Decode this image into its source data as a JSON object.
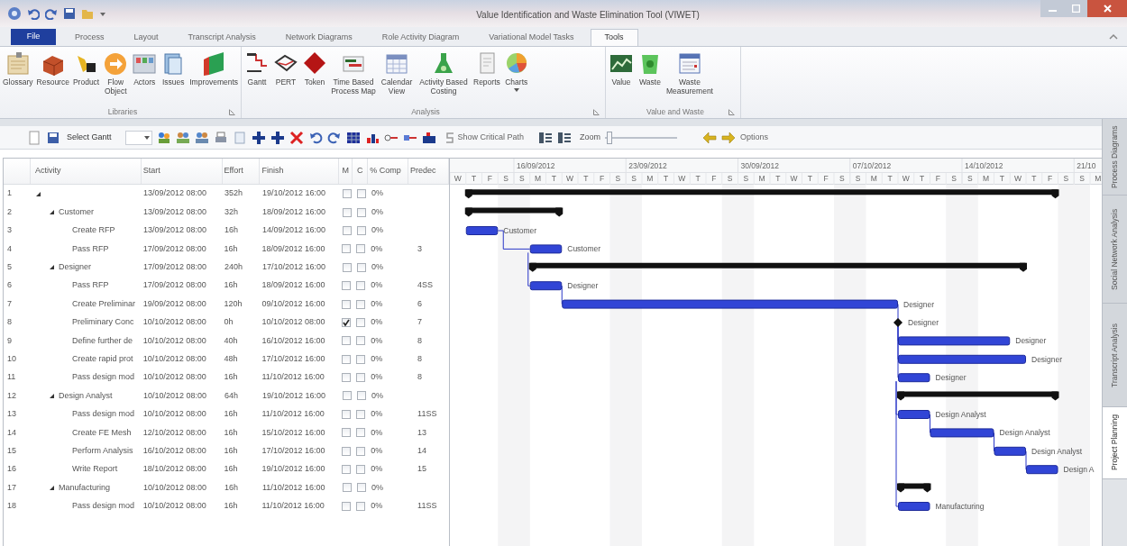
{
  "window": {
    "title": "Value Identification and Waste Elimination Tool (VIWET)"
  },
  "ribbon": {
    "tabs": [
      {
        "label": "File",
        "selected": false
      },
      {
        "label": "Process",
        "selected": false
      },
      {
        "label": "Layout",
        "selected": false
      },
      {
        "label": "Transcript Analysis",
        "selected": false
      },
      {
        "label": "Network Diagrams",
        "selected": false
      },
      {
        "label": "Role Activity Diagram",
        "selected": false
      },
      {
        "label": "Variational Model Tasks",
        "selected": false
      },
      {
        "label": "Tools",
        "selected": true
      }
    ],
    "groups": [
      {
        "label": "Libraries",
        "buttons": [
          {
            "label": "Glossary"
          },
          {
            "label": "Resource"
          },
          {
            "label": "Product"
          },
          {
            "label": "Flow Object"
          },
          {
            "label": "Actors"
          },
          {
            "label": "Issues"
          },
          {
            "label": "Improvements"
          }
        ]
      },
      {
        "label": "Analysis",
        "buttons": [
          {
            "label": "Gantt"
          },
          {
            "label": "PERT"
          },
          {
            "label": "Token"
          },
          {
            "label": "Time Based Process Map"
          },
          {
            "label": "Calendar View"
          },
          {
            "label": "Activity Based Costing"
          },
          {
            "label": "Reports"
          },
          {
            "label": "Charts"
          }
        ]
      },
      {
        "label": "Value and Waste",
        "buttons": [
          {
            "label": "Value"
          },
          {
            "label": "Waste"
          },
          {
            "label": "Waste Measurement"
          }
        ]
      }
    ]
  },
  "toolbar": {
    "select_gantt": "Select Gantt",
    "critical_path": "Show Critical Path",
    "zoom_label": "Zoom",
    "zoom": {
      "level": 0.02
    },
    "options": "Options"
  },
  "grid": {
    "columns": [
      "Activity",
      "Start",
      "Effort",
      "Finish",
      "M",
      "C",
      "% Comp",
      "Predec"
    ],
    "rows": [
      {
        "number": "1",
        "expanded": true,
        "start": "13/09/2012 08:00",
        "effort": "352h",
        "finish": "19/10/2012 16:00",
        "milestone": false,
        "critical": false,
        "complete": "0%",
        "children": [
          {
            "number": "2",
            "name": "Customer",
            "expanded": true,
            "start": "13/09/2012 08:00",
            "effort": "32h",
            "finish": "18/09/2012 16:00",
            "milestone": false,
            "critical": false,
            "complete": "0%",
            "children": [
              {
                "number": "3",
                "name": "Create RFP",
                "start": "13/09/2012 08:00",
                "effort": "16h",
                "finish": "14/09/2012 16:00",
                "milestone": false,
                "critical": false,
                "complete": "0%",
                "bar_label": "Customer"
              },
              {
                "number": "4",
                "name": "Pass RFP",
                "start": "17/09/2012 08:00",
                "effort": "16h",
                "finish": "18/09/2012 16:00",
                "milestone": false,
                "critical": false,
                "complete": "0%",
                "predecessors": "3",
                "bar_label": "Customer"
              }
            ]
          },
          {
            "number": "5",
            "name": "Designer",
            "expanded": true,
            "start": "17/09/2012 08:00",
            "effort": "240h",
            "finish": "17/10/2012 16:00",
            "milestone": false,
            "critical": false,
            "complete": "0%",
            "children": [
              {
                "number": "6",
                "name": "Pass RFP",
                "start": "17/09/2012 08:00",
                "effort": "16h",
                "finish": "18/09/2012 16:00",
                "milestone": false,
                "critical": false,
                "complete": "0%",
                "predecessors": "4SS",
                "bar_label": "Designer"
              },
              {
                "number": "7",
                "name": "Create Preliminar",
                "start": "19/09/2012 08:00",
                "effort": "120h",
                "finish": "09/10/2012 16:00",
                "milestone": false,
                "critical": false,
                "complete": "0%",
                "predecessors": "6",
                "bar_label": "Designer"
              },
              {
                "number": "8",
                "name": "Preliminary Conc",
                "start": "10/10/2012 08:00",
                "effort": "0h",
                "finish": "10/10/2012 08:00",
                "milestone": true,
                "critical": false,
                "complete": "0%",
                "predecessors": "7",
                "bar_label": "Designer"
              },
              {
                "number": "9",
                "name": "Define further de",
                "start": "10/10/2012 08:00",
                "effort": "40h",
                "finish": "16/10/2012 16:00",
                "milestone": false,
                "critical": false,
                "complete": "0%",
                "predecessors": "8",
                "bar_label": "Designer"
              },
              {
                "number": "10",
                "name": "Create rapid prot",
                "start": "10/10/2012 08:00",
                "effort": "48h",
                "finish": "17/10/2012 16:00",
                "milestone": false,
                "critical": false,
                "complete": "0%",
                "predecessors": "8",
                "bar_label": "Designer"
              },
              {
                "number": "11",
                "name": "Pass design mod",
                "start": "10/10/2012 08:00",
                "effort": "16h",
                "finish": "11/10/2012 16:00",
                "milestone": false,
                "critical": false,
                "complete": "0%",
                "predecessors": "8",
                "bar_label": "Designer"
              }
            ]
          },
          {
            "number": "12",
            "name": "Design Analyst",
            "expanded": true,
            "start": "10/10/2012 08:00",
            "effort": "64h",
            "finish": "19/10/2012 16:00",
            "milestone": false,
            "critical": false,
            "complete": "0%",
            "children": [
              {
                "number": "13",
                "name": "Pass design mod",
                "start": "10/10/2012 08:00",
                "effort": "16h",
                "finish": "11/10/2012 16:00",
                "milestone": false,
                "critical": false,
                "complete": "0%",
                "predecessors": "11SS",
                "bar_label": "Design Analyst"
              },
              {
                "number": "14",
                "name": "Create FE Mesh",
                "start": "12/10/2012 08:00",
                "effort": "16h",
                "finish": "15/10/2012 16:00",
                "milestone": false,
                "critical": false,
                "complete": "0%",
                "predecessors": "13",
                "bar_label": "Design Analyst"
              },
              {
                "number": "15",
                "name": "Perform Analysis",
                "start": "16/10/2012 08:00",
                "effort": "16h",
                "finish": "17/10/2012 16:00",
                "milestone": false,
                "critical": false,
                "complete": "0%",
                "predecessors": "14",
                "bar_label": "Design Analyst"
              },
              {
                "number": "16",
                "name": "Write Report",
                "start": "18/10/2012 08:00",
                "effort": "16h",
                "finish": "19/10/2012 16:00",
                "milestone": false,
                "critical": false,
                "complete": "0%",
                "predecessors": "15",
                "bar_label": "Design A"
              }
            ]
          },
          {
            "number": "17",
            "name": "Manufacturing",
            "expanded": true,
            "start": "10/10/2012 08:00",
            "effort": "16h",
            "finish": "11/10/2012 16:00",
            "milestone": false,
            "critical": false,
            "complete": "0%",
            "children": [
              {
                "number": "18",
                "name": "Pass design mod",
                "start": "10/10/2012 08:00",
                "effort": "16h",
                "finish": "11/10/2012 16:00",
                "milestone": false,
                "critical": false,
                "complete": "0%",
                "predecessors": "11SS",
                "bar_label": "Manufacturing"
              }
            ]
          }
        ]
      }
    ]
  },
  "gantt": {
    "weeks": [
      {
        "days": [
          "W",
          "T",
          "F",
          "S"
        ]
      },
      {
        "label": "16/09/2012",
        "days": [
          "S",
          "M",
          "T",
          "W",
          "T",
          "F",
          "S"
        ]
      },
      {
        "label": "23/09/2012",
        "days": [
          "S",
          "M",
          "T",
          "W",
          "T",
          "F",
          "S"
        ]
      },
      {
        "label": "30/09/2012",
        "days": [
          "S",
          "M",
          "T",
          "W",
          "T",
          "F",
          "S"
        ]
      },
      {
        "label": "07/10/2012",
        "days": [
          "S",
          "M",
          "T",
          "W",
          "T",
          "F",
          "S"
        ]
      },
      {
        "label": "14/10/2012",
        "days": [
          "S",
          "M",
          "T",
          "W",
          "T",
          "F",
          "S"
        ]
      },
      {
        "label": "21/10",
        "days": [
          "S",
          "M"
        ]
      }
    ]
  },
  "side_tabs": [
    {
      "label": "Process Diagrams",
      "selected": false
    },
    {
      "label": "Social Network Analysis",
      "selected": false
    },
    {
      "label": "Transcript Analysis",
      "selected": false
    },
    {
      "label": "Project Planning",
      "selected": true
    }
  ]
}
